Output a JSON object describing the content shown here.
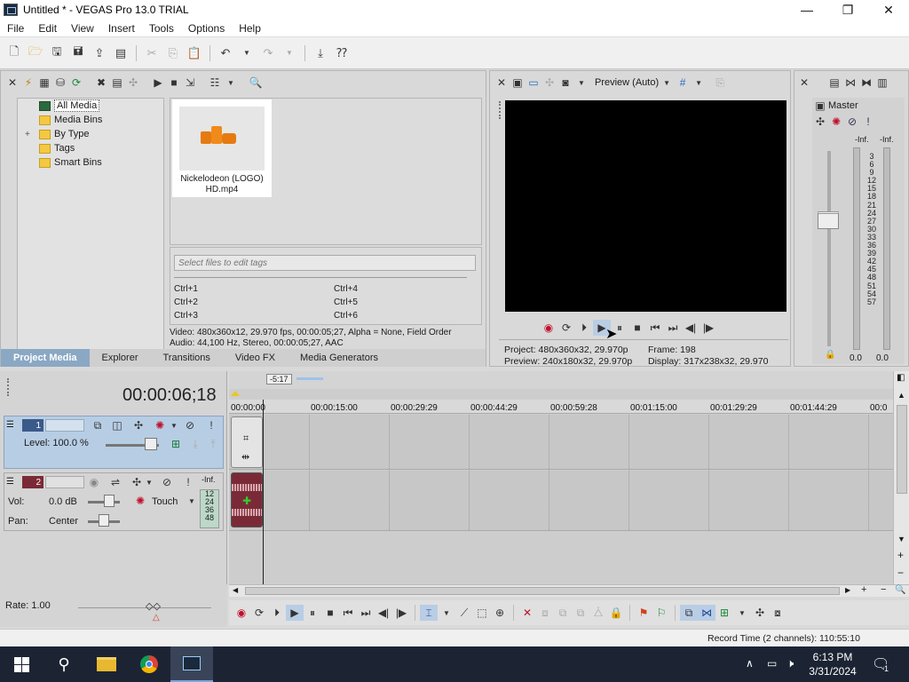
{
  "window": {
    "title": "Untitled * - VEGAS Pro 13.0 TRIAL",
    "minimize": "—",
    "restore": "❐",
    "close": "✕"
  },
  "menu": [
    "File",
    "Edit",
    "View",
    "Insert",
    "Tools",
    "Options",
    "Help"
  ],
  "media_tree": [
    "All Media",
    "Media Bins",
    "By Type",
    "Tags",
    "Smart Bins"
  ],
  "media_tree_expand": "+",
  "media_item": {
    "name": "Nickelodeon (LOGO) HD.mp4"
  },
  "tags": {
    "placeholder": "Select files to edit tags",
    "shortcuts": [
      "Ctrl+1",
      "Ctrl+4",
      "Ctrl+2",
      "Ctrl+5",
      "Ctrl+3",
      "Ctrl+6"
    ]
  },
  "media_info": {
    "video": "Video: 480x360x12, 29.970 fps, 00:00:05;27, Alpha = None, Field Order",
    "audio": "Audio: 44,100 Hz, Stereo, 00:00:05;27, AAC"
  },
  "panel_tabs": [
    "Project Media",
    "Explorer",
    "Transitions",
    "Video FX",
    "Media Generators"
  ],
  "preview": {
    "mode": "Preview (Auto)",
    "project": "Project:  480x360x32, 29.970p",
    "frame": "Frame:    198",
    "preview": "Preview:  240x180x32, 29.970p",
    "display": "Display:    317x238x32, 29.970"
  },
  "master": {
    "title": "Master",
    "top_left": "-Inf.",
    "top_right": "-Inf.",
    "scale": [
      "3",
      "6",
      "9",
      "12",
      "15",
      "18",
      "21",
      "24",
      "27",
      "30",
      "33",
      "36",
      "39",
      "42",
      "45",
      "48",
      "51",
      "54",
      "57"
    ],
    "bottom_left": "0.0",
    "bottom_right": "0.0"
  },
  "timeline": {
    "timecode": "00:00:06;18",
    "loop_label": "-5:17",
    "ruler": [
      "00:00:00",
      "00:00:15:00",
      "00:00:29:29",
      "00:00:44:29",
      "00:00:59:28",
      "00:01:15:00",
      "00:01:29:29",
      "00:01:44:29",
      "00:0"
    ],
    "track1": {
      "num": "1",
      "level": "Level: 100.0 %"
    },
    "track2": {
      "num": "2",
      "vol": "Vol:",
      "vol_value": "0.0 dB",
      "pan": "Pan:",
      "pan_value": "Center",
      "mode": "Touch",
      "meter_inf": "-Inf.",
      "meter_scale": [
        "12",
        "24",
        "36",
        "48"
      ]
    }
  },
  "transport": {
    "rate": "Rate: 1.00"
  },
  "status": {
    "record_time": "Record Time (2 channels): 110:55:10"
  },
  "taskbar": {
    "time": "6:13 PM",
    "date": "3/31/2024",
    "notification_count": "1"
  },
  "colors": {
    "accent": "#8aa8c4",
    "video_track": "#b7cde4",
    "audio_clip": "#7a2a36",
    "taskbar": "#1c2434"
  }
}
